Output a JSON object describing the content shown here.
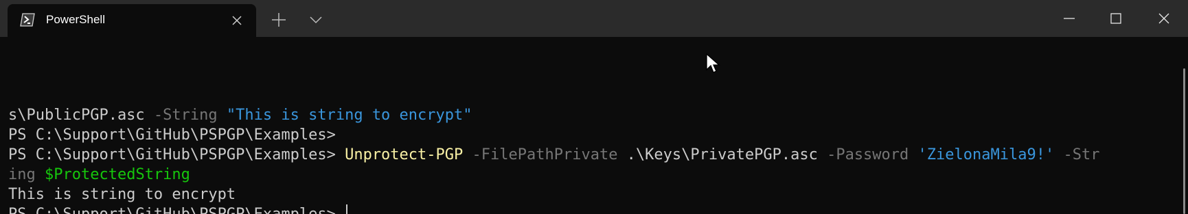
{
  "window": {
    "tab": {
      "title": "PowerShell",
      "icon": "powershell-icon"
    },
    "controls": {
      "new_tab_icon": "plus-icon",
      "dropdown_icon": "chevron-down-icon",
      "minimize_icon": "minimize-icon",
      "maximize_icon": "maximize-icon",
      "close_icon": "close-icon"
    }
  },
  "terminal": {
    "lines": [
      [
        {
          "text": "s\\PublicPGP.asc ",
          "type": "text"
        },
        {
          "text": "-String",
          "type": "param"
        },
        {
          "text": " ",
          "type": "text"
        },
        {
          "text": "\"This is string to encrypt\"",
          "type": "string"
        }
      ],
      [
        {
          "text": "PS C:\\Support\\GitHub\\PSPGP\\Examples>",
          "type": "text"
        }
      ],
      [
        {
          "text": "PS C:\\Support\\GitHub\\PSPGP\\Examples> ",
          "type": "text"
        },
        {
          "text": "Unprotect-PGP",
          "type": "command"
        },
        {
          "text": " ",
          "type": "text"
        },
        {
          "text": "-FilePathPrivate",
          "type": "param"
        },
        {
          "text": " .\\Keys\\PrivatePGP.asc ",
          "type": "text"
        },
        {
          "text": "-Password",
          "type": "param"
        },
        {
          "text": " ",
          "type": "text"
        },
        {
          "text": "'ZielonaMila9!'",
          "type": "string"
        },
        {
          "text": " ",
          "type": "text"
        },
        {
          "text": "-Str",
          "type": "param"
        }
      ],
      [
        {
          "text": "ing",
          "type": "param"
        },
        {
          "text": " ",
          "type": "text"
        },
        {
          "text": "$ProtectedString",
          "type": "var"
        }
      ],
      [
        {
          "text": "This is string to encrypt",
          "type": "text"
        }
      ],
      [
        {
          "text": "PS C:\\Support\\GitHub\\PSPGP\\Examples> ",
          "type": "text"
        }
      ]
    ],
    "cursor_line": 5
  },
  "colors": {
    "background": "#0c0c0c",
    "titlebar": "#2b2b2b",
    "text": "#cccccc",
    "param": "#767676",
    "string": "#3a96dd",
    "command": "#f9f1a5",
    "variable": "#16c60c"
  }
}
